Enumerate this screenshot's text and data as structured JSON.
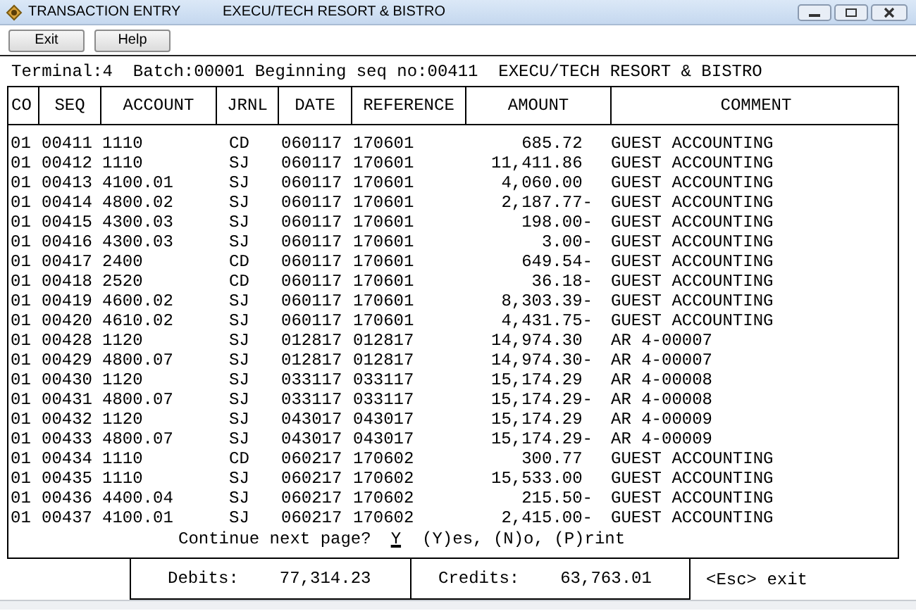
{
  "window": {
    "title": "TRANSACTION ENTRY",
    "subtitle": "EXECU/TECH RESORT & BISTRO"
  },
  "toolbar": {
    "buttons": [
      "Exit",
      "Help"
    ]
  },
  "header_line": "Terminal:4  Batch:00001 Beginning seq no:00411  EXECU/TECH RESORT & BISTRO",
  "table": {
    "columns": [
      "CO",
      "SEQ",
      "ACCOUNT",
      "JRNL",
      "DATE",
      "REFERENCE",
      "AMOUNT",
      "COMMENT"
    ],
    "rows": [
      [
        "01",
        "00411",
        "1110",
        "CD",
        "060117",
        "170601",
        "685.72",
        "GUEST ACCOUNTING"
      ],
      [
        "01",
        "00412",
        "1110",
        "SJ",
        "060117",
        "170601",
        "11,411.86",
        "GUEST ACCOUNTING"
      ],
      [
        "01",
        "00413",
        "4100.01",
        "SJ",
        "060117",
        "170601",
        "4,060.00",
        "GUEST ACCOUNTING"
      ],
      [
        "01",
        "00414",
        "4800.02",
        "SJ",
        "060117",
        "170601",
        "2,187.77-",
        "GUEST ACCOUNTING"
      ],
      [
        "01",
        "00415",
        "4300.03",
        "SJ",
        "060117",
        "170601",
        "198.00-",
        "GUEST ACCOUNTING"
      ],
      [
        "01",
        "00416",
        "4300.03",
        "SJ",
        "060117",
        "170601",
        "3.00-",
        "GUEST ACCOUNTING"
      ],
      [
        "01",
        "00417",
        "2400",
        "CD",
        "060117",
        "170601",
        "649.54-",
        "GUEST ACCOUNTING"
      ],
      [
        "01",
        "00418",
        "2520",
        "CD",
        "060117",
        "170601",
        "36.18-",
        "GUEST ACCOUNTING"
      ],
      [
        "01",
        "00419",
        "4600.02",
        "SJ",
        "060117",
        "170601",
        "8,303.39-",
        "GUEST ACCOUNTING"
      ],
      [
        "01",
        "00420",
        "4610.02",
        "SJ",
        "060117",
        "170601",
        "4,431.75-",
        "GUEST ACCOUNTING"
      ],
      [
        "01",
        "00428",
        "1120",
        "SJ",
        "012817",
        "012817",
        "14,974.30",
        "AR 4-00007"
      ],
      [
        "01",
        "00429",
        "4800.07",
        "SJ",
        "012817",
        "012817",
        "14,974.30-",
        "AR 4-00007"
      ],
      [
        "01",
        "00430",
        "1120",
        "SJ",
        "033117",
        "033117",
        "15,174.29",
        "AR 4-00008"
      ],
      [
        "01",
        "00431",
        "4800.07",
        "SJ",
        "033117",
        "033117",
        "15,174.29-",
        "AR 4-00008"
      ],
      [
        "01",
        "00432",
        "1120",
        "SJ",
        "043017",
        "043017",
        "15,174.29",
        "AR 4-00009"
      ],
      [
        "01",
        "00433",
        "4800.07",
        "SJ",
        "043017",
        "043017",
        "15,174.29-",
        "AR 4-00009"
      ],
      [
        "01",
        "00434",
        "1110",
        "CD",
        "060217",
        "170602",
        "300.77",
        "GUEST ACCOUNTING"
      ],
      [
        "01",
        "00435",
        "1110",
        "SJ",
        "060217",
        "170602",
        "15,533.00",
        "GUEST ACCOUNTING"
      ],
      [
        "01",
        "00436",
        "4400.04",
        "SJ",
        "060217",
        "170602",
        "215.50-",
        "GUEST ACCOUNTING"
      ],
      [
        "01",
        "00437",
        "4100.01",
        "SJ",
        "060217",
        "170602",
        "2,415.00-",
        "GUEST ACCOUNTING"
      ]
    ]
  },
  "prompt": {
    "label": "Continue next page?",
    "value": "Y",
    "options": "(Y)es, (N)o, (P)rint"
  },
  "totals": {
    "debits_label": "Debits:",
    "debits": "77,314.23",
    "credits_label": "Credits:",
    "credits": "63,763.01",
    "hint": "<Esc> exit"
  }
}
